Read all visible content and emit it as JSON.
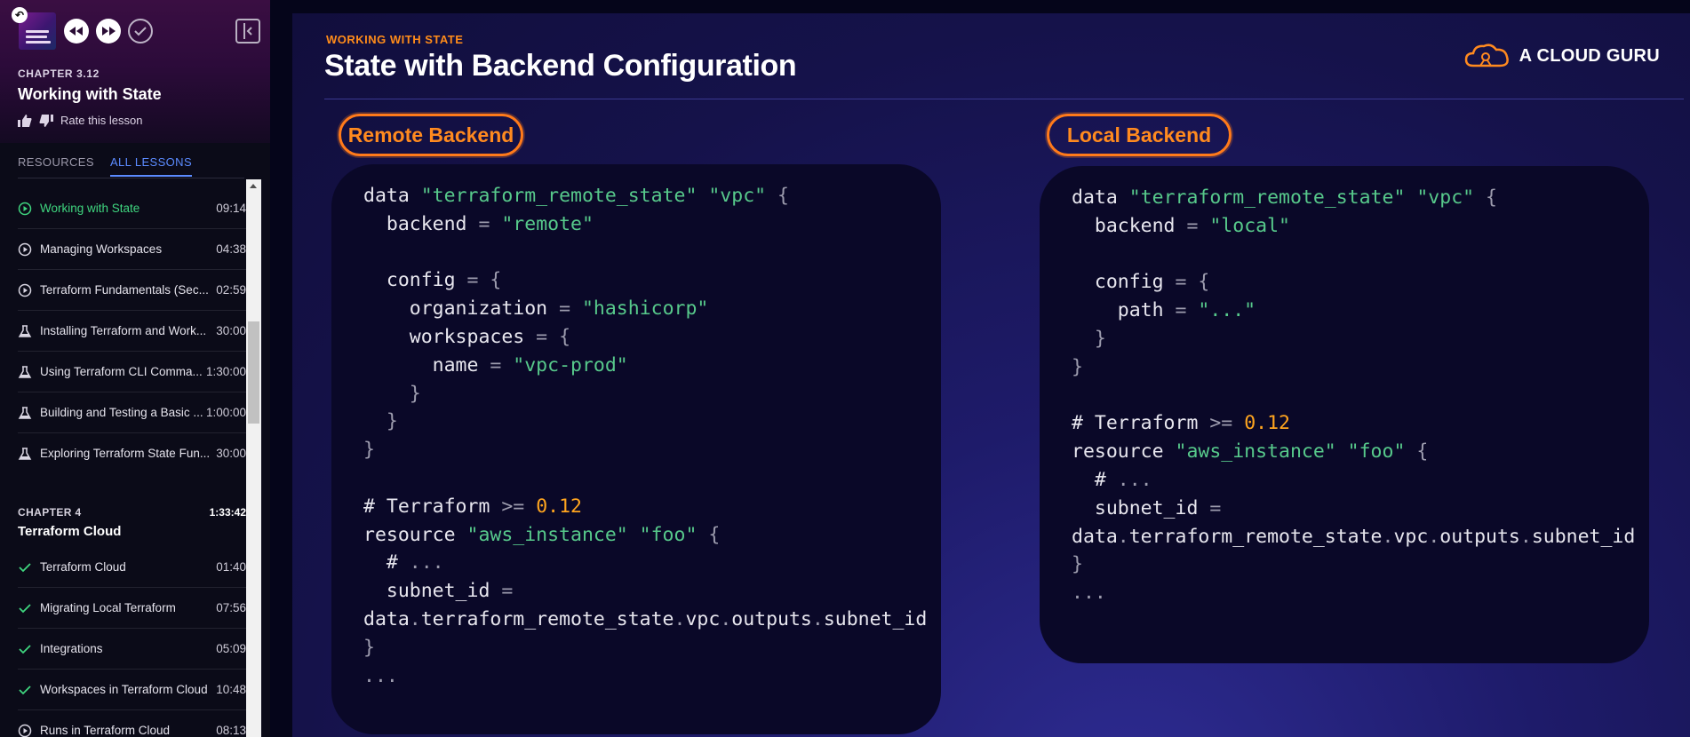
{
  "sidebar": {
    "chapter_label": "CHAPTER 3.12",
    "chapter_title": "Working with State",
    "rate_text": "Rate this lesson",
    "tabs": [
      {
        "label": "RESOURCES",
        "active": false
      },
      {
        "label": "ALL LESSONS",
        "active": true
      }
    ],
    "lessons": [
      {
        "title": "Working with State",
        "duration": "09:14",
        "icon": "play-circle-icon",
        "current": true
      },
      {
        "title": "Managing Workspaces",
        "duration": "04:38",
        "icon": "play-circle-icon"
      },
      {
        "title": "Terraform Fundamentals (Sec...",
        "duration": "02:59",
        "icon": "play-circle-icon"
      },
      {
        "title": "Installing Terraform and Work...",
        "duration": "30:00",
        "icon": "lab-flask-icon"
      },
      {
        "title": "Using Terraform CLI Comma...",
        "duration": "1:30:00",
        "icon": "lab-flask-icon"
      },
      {
        "title": "Building and Testing a Basic ...",
        "duration": "1:00:00",
        "icon": "lab-flask-icon"
      },
      {
        "title": "Exploring Terraform State Fun...",
        "duration": "30:00",
        "icon": "lab-flask-icon"
      }
    ],
    "chapter4": {
      "label": "CHAPTER 4",
      "duration": "1:33:42",
      "title": "Terraform Cloud",
      "lessons": [
        {
          "title": "Terraform Cloud",
          "duration": "01:40",
          "icon": "check-icon"
        },
        {
          "title": "Migrating Local Terraform",
          "duration": "07:56",
          "icon": "check-icon"
        },
        {
          "title": "Integrations",
          "duration": "05:09",
          "icon": "check-icon"
        },
        {
          "title": "Workspaces in Terraform Cloud",
          "duration": "10:48",
          "icon": "check-icon"
        },
        {
          "title": "Runs in Terraform Cloud",
          "duration": "08:13",
          "icon": "play-circle-icon"
        }
      ]
    },
    "colors": {
      "current_lesson": "#3fd67f",
      "active_tab": "#5b8bff"
    }
  },
  "slide": {
    "kicker": "WORKING WITH STATE",
    "title": "State with Backend Configuration",
    "brand": "A CLOUD GURU",
    "left_label": "Remote Backend",
    "right_label": "Local Backend",
    "colors": {
      "accent": "#ff7a1a",
      "string": "#57c98b",
      "number": "#ffa51f"
    }
  }
}
